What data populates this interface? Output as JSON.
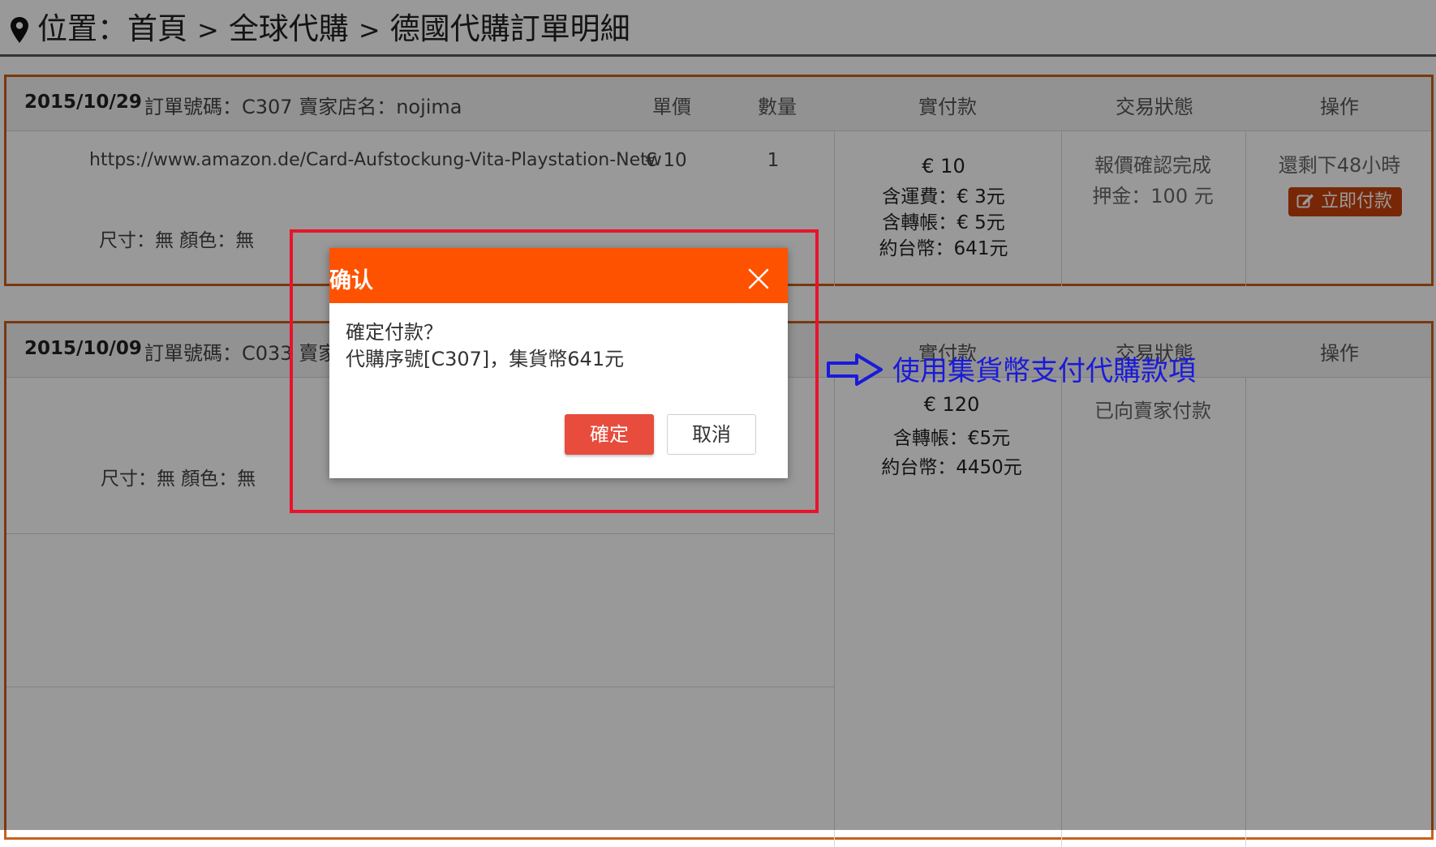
{
  "breadcrumb": {
    "label": "位置：首頁",
    "items": [
      "全球代購",
      "德國代購訂單明細"
    ],
    "separator": ">"
  },
  "table_headers": {
    "unit_price": "單價",
    "quantity": "數量",
    "paid": "實付款",
    "status": "交易狀態",
    "action": "操作"
  },
  "orders": [
    {
      "date": "2015/10/29",
      "info": "訂單號碼：C307  賣家店名：nojima",
      "product_url": "https://www.amazon.de/Card-Aufstockung-Vita-Playstation-Netw",
      "options": "尺寸：無    顏色：無",
      "unit_price": "€ 10",
      "quantity": "1",
      "amount_main": "€ 10",
      "amount_lines": [
        "含運費：€ 3元",
        "含轉帳：€ 5元",
        "約台幣：641元"
      ],
      "status_lines": [
        "報價確認完成",
        "押金：100 元"
      ],
      "action_note": "還剩下48小時",
      "action_button": "立即付款"
    },
    {
      "date": "2015/10/09",
      "info": "訂單號碼：C033",
      "info_cut": "賣家",
      "options": "尺寸：無    顏色：無",
      "amount_main": "€ 120",
      "amount_lines": [
        "含轉帳：€5元",
        "約台幣：4450元"
      ],
      "status_lines": [
        "已向賣家付款"
      ]
    }
  ],
  "dialog": {
    "title": "确认",
    "message_line1": "確定付款？",
    "message_line2": "代購序號[C307]，集貨幣641元",
    "confirm_label": "確定",
    "cancel_label": "取消"
  },
  "annotation": {
    "text": "使用集貨幣支付代購款項"
  },
  "colors": {
    "accent_orange": "#ff5200",
    "card_border": "#c9601c",
    "pay_button": "#c9420a",
    "confirm_button": "#e74c3c",
    "annotation_box": "#e8132b",
    "annotation_text": "#1a1adb"
  },
  "icons": [
    "location-pin-icon",
    "edit-icon",
    "close-icon",
    "arrow-right-icon"
  ]
}
